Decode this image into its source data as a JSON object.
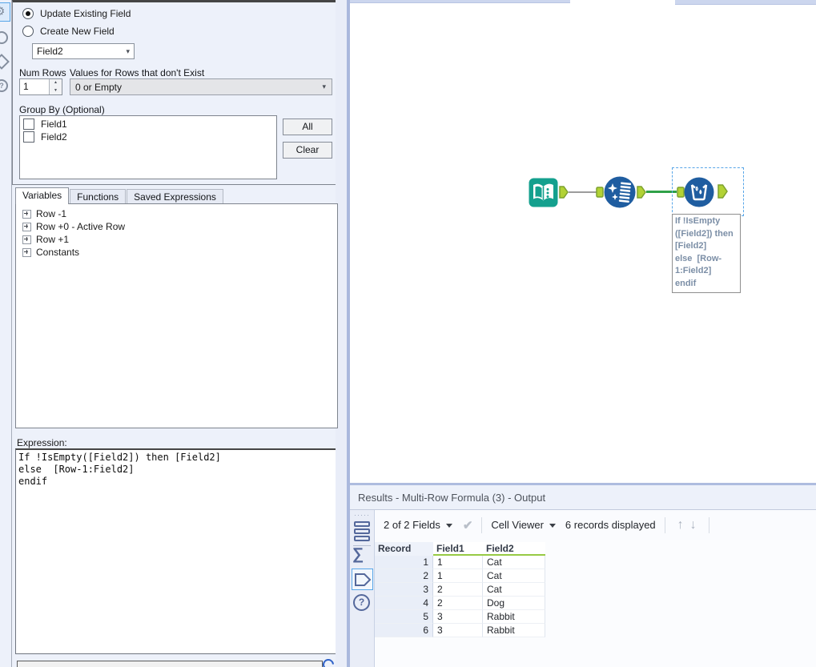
{
  "config": {
    "radios": [
      {
        "label": "Update Existing Field",
        "selected": true
      },
      {
        "label": "Create New Field",
        "selected": false
      }
    ],
    "field_select": {
      "value": "Field2"
    },
    "num_rows": {
      "label": "Num Rows",
      "value": "1"
    },
    "values_combo": {
      "label": "Values for Rows that don't Exist",
      "value": "0 or Empty"
    },
    "group_by": {
      "label": "Group By (Optional)",
      "items": [
        {
          "label": "Field1",
          "checked": false
        },
        {
          "label": "Field2",
          "checked": false
        }
      ],
      "all_button": "All",
      "clear_button": "Clear"
    },
    "tabs": [
      {
        "label": "Variables",
        "active": true
      },
      {
        "label": "Functions",
        "active": false
      },
      {
        "label": "Saved Expressions",
        "active": false
      }
    ],
    "variables_tree": [
      {
        "label": "Row -1"
      },
      {
        "label": "Row +0 - Active Row"
      },
      {
        "label": "Row +1"
      },
      {
        "label": "Constants"
      }
    ],
    "expression": {
      "label": "Expression:",
      "value": "If !IsEmpty([Field2]) then [Field2]\nelse  [Row-1:Field2]\nendif"
    }
  },
  "canvas": {
    "tools": [
      {
        "icon": "text-input-tool-icon"
      },
      {
        "icon": "data-cleansing-tool-icon"
      },
      {
        "icon": "multi-row-formula-tool-icon",
        "selected": true
      }
    ],
    "annotation": "If !IsEmpty\n([Field2]) then\n[Field2]\nelse  [Row-\n1:Field2]\nendif"
  },
  "results": {
    "title": "Results - Multi-Row Formula (3) - Output",
    "toolbar": {
      "fields_summary": "2 of 2 Fields",
      "cell_viewer_label": "Cell Viewer",
      "records_label": "6 records displayed"
    },
    "table": {
      "columns": [
        "Record",
        "Field1",
        "Field2"
      ],
      "rows": [
        {
          "record": "1",
          "field1": "1",
          "field2": "Cat"
        },
        {
          "record": "2",
          "field1": "1",
          "field2": "Cat"
        },
        {
          "record": "3",
          "field1": "2",
          "field2": "Cat"
        },
        {
          "record": "4",
          "field1": "2",
          "field2": "Dog"
        },
        {
          "record": "5",
          "field1": "3",
          "field2": "Rabbit"
        },
        {
          "record": "6",
          "field1": "3",
          "field2": "Rabbit"
        }
      ]
    }
  },
  "icons": {
    "gear-icon": "⚙",
    "sigma-icon": "∑",
    "check-icon": "✔",
    "up-arrow-icon": "↑",
    "down-arrow-icon": "↓"
  },
  "colors": {
    "accent_green": "#97ca44",
    "tool_blue": "#1f5da0",
    "teal": "#14a08e",
    "anchor_green": "#b2d235",
    "wire_green": "#2fa148",
    "selection_blue": "#58a6e8"
  }
}
